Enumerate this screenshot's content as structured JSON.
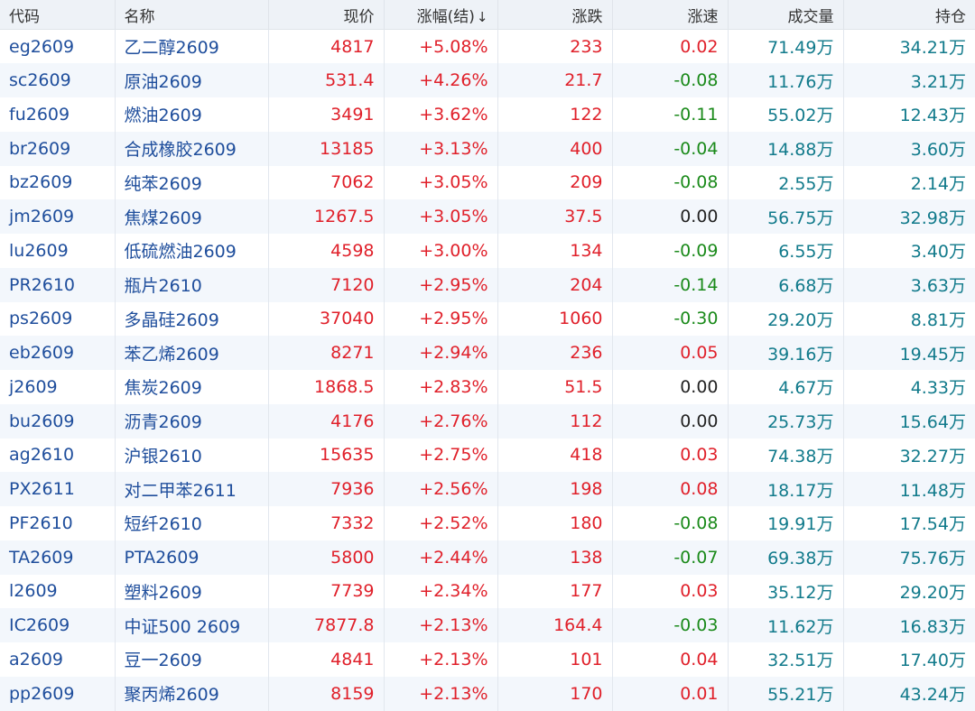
{
  "columns": {
    "code": "代码",
    "name": "名称",
    "price": "现价",
    "pct": "涨幅(结)",
    "sort_arrow": "↓",
    "change": "涨跌",
    "speed": "涨速",
    "volume": "成交量",
    "oi": "持仓"
  },
  "colors": {
    "up": "#e0202a",
    "down": "#1a8a1a",
    "neutral": "#222222",
    "link": "#1f4e9c",
    "volume": "#117a8b"
  },
  "rows": [
    {
      "code": "eg2609",
      "name": "乙二醇2609",
      "price": "4817",
      "pct": "+5.08%",
      "change": "233",
      "speed": "0.02",
      "volume": "71.49万",
      "oi": "34.21万"
    },
    {
      "code": "sc2609",
      "name": "原油2609",
      "price": "531.4",
      "pct": "+4.26%",
      "change": "21.7",
      "speed": "-0.08",
      "volume": "11.76万",
      "oi": "3.21万"
    },
    {
      "code": "fu2609",
      "name": "燃油2609",
      "price": "3491",
      "pct": "+3.62%",
      "change": "122",
      "speed": "-0.11",
      "volume": "55.02万",
      "oi": "12.43万"
    },
    {
      "code": "br2609",
      "name": "合成橡胶2609",
      "price": "13185",
      "pct": "+3.13%",
      "change": "400",
      "speed": "-0.04",
      "volume": "14.88万",
      "oi": "3.60万"
    },
    {
      "code": "bz2609",
      "name": "纯苯2609",
      "price": "7062",
      "pct": "+3.05%",
      "change": "209",
      "speed": "-0.08",
      "volume": "2.55万",
      "oi": "2.14万"
    },
    {
      "code": "jm2609",
      "name": "焦煤2609",
      "price": "1267.5",
      "pct": "+3.05%",
      "change": "37.5",
      "speed": "0.00",
      "volume": "56.75万",
      "oi": "32.98万"
    },
    {
      "code": "lu2609",
      "name": "低硫燃油2609",
      "price": "4598",
      "pct": "+3.00%",
      "change": "134",
      "speed": "-0.09",
      "volume": "6.55万",
      "oi": "3.40万"
    },
    {
      "code": "PR2610",
      "name": "瓶片2610",
      "price": "7120",
      "pct": "+2.95%",
      "change": "204",
      "speed": "-0.14",
      "volume": "6.68万",
      "oi": "3.63万"
    },
    {
      "code": "ps2609",
      "name": "多晶硅2609",
      "price": "37040",
      "pct": "+2.95%",
      "change": "1060",
      "speed": "-0.30",
      "volume": "29.20万",
      "oi": "8.81万"
    },
    {
      "code": "eb2609",
      "name": "苯乙烯2609",
      "price": "8271",
      "pct": "+2.94%",
      "change": "236",
      "speed": "0.05",
      "volume": "39.16万",
      "oi": "19.45万"
    },
    {
      "code": "j2609",
      "name": "焦炭2609",
      "price": "1868.5",
      "pct": "+2.83%",
      "change": "51.5",
      "speed": "0.00",
      "volume": "4.67万",
      "oi": "4.33万"
    },
    {
      "code": "bu2609",
      "name": "沥青2609",
      "price": "4176",
      "pct": "+2.76%",
      "change": "112",
      "speed": "0.00",
      "volume": "25.73万",
      "oi": "15.64万"
    },
    {
      "code": "ag2610",
      "name": "沪银2610",
      "price": "15635",
      "pct": "+2.75%",
      "change": "418",
      "speed": "0.03",
      "volume": "74.38万",
      "oi": "32.27万"
    },
    {
      "code": "PX2611",
      "name": "对二甲苯2611",
      "price": "7936",
      "pct": "+2.56%",
      "change": "198",
      "speed": "0.08",
      "volume": "18.17万",
      "oi": "11.48万"
    },
    {
      "code": "PF2610",
      "name": "短纤2610",
      "price": "7332",
      "pct": "+2.52%",
      "change": "180",
      "speed": "-0.08",
      "volume": "19.91万",
      "oi": "17.54万"
    },
    {
      "code": "TA2609",
      "name": "PTA2609",
      "price": "5800",
      "pct": "+2.44%",
      "change": "138",
      "speed": "-0.07",
      "volume": "69.38万",
      "oi": "75.76万"
    },
    {
      "code": "l2609",
      "name": "塑料2609",
      "price": "7739",
      "pct": "+2.34%",
      "change": "177",
      "speed": "0.03",
      "volume": "35.12万",
      "oi": "29.20万"
    },
    {
      "code": "IC2609",
      "name": "中证500 2609",
      "price": "7877.8",
      "pct": "+2.13%",
      "change": "164.4",
      "speed": "-0.03",
      "volume": "11.62万",
      "oi": "16.83万"
    },
    {
      "code": "a2609",
      "name": "豆一2609",
      "price": "4841",
      "pct": "+2.13%",
      "change": "101",
      "speed": "0.04",
      "volume": "32.51万",
      "oi": "17.40万"
    },
    {
      "code": "pp2609",
      "name": "聚丙烯2609",
      "price": "8159",
      "pct": "+2.13%",
      "change": "170",
      "speed": "0.01",
      "volume": "55.21万",
      "oi": "43.24万"
    }
  ]
}
